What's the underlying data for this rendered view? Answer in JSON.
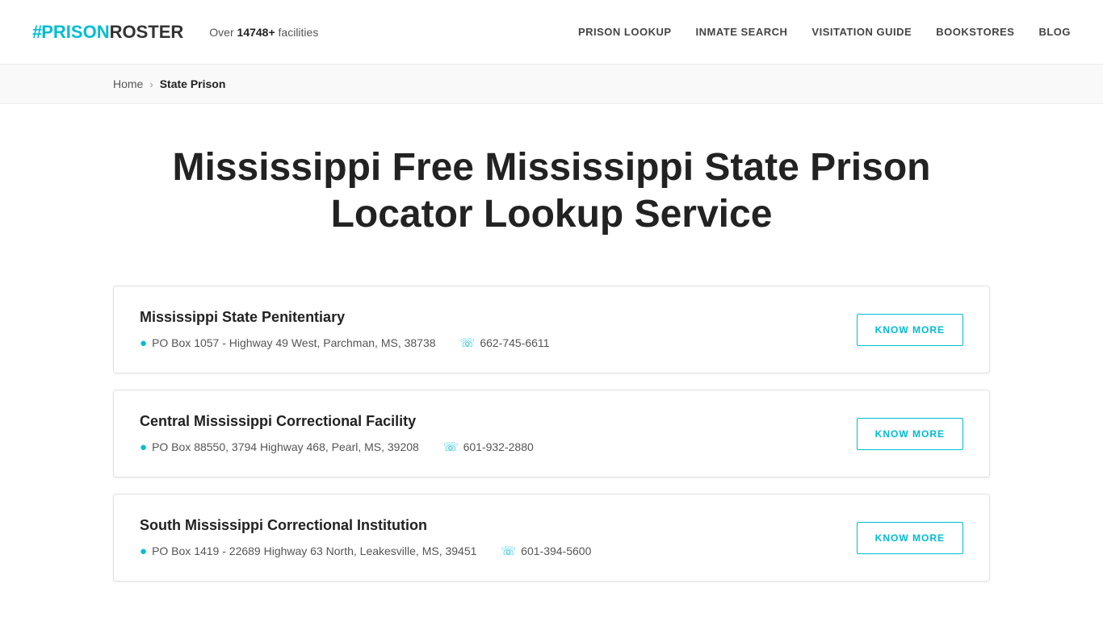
{
  "header": {
    "logo": {
      "hash": "#",
      "prison": "PRISON",
      "roster": "ROSTER"
    },
    "facilities_text": "Over ",
    "facilities_count": "14748+",
    "facilities_suffix": " facilities",
    "nav": [
      {
        "id": "prison-lookup",
        "label": "PRISON LOOKUP"
      },
      {
        "id": "inmate-search",
        "label": "INMATE SEARCH"
      },
      {
        "id": "visitation-guide",
        "label": "VISITATION GUIDE"
      },
      {
        "id": "bookstores",
        "label": "BOOKSTORES"
      },
      {
        "id": "blog",
        "label": "BLOG"
      }
    ]
  },
  "breadcrumb": {
    "home": "Home",
    "separator": "›",
    "current": "State Prison"
  },
  "page": {
    "title": "Mississippi Free Mississippi State Prison Locator Lookup Service"
  },
  "facilities": [
    {
      "id": "mississippi-state-penitentiary",
      "name": "Mississippi State Penitentiary",
      "address": "PO Box 1057 - Highway 49 West, Parchman, MS, 38738",
      "phone": "662-745-6611",
      "button_label": "KNOW MORE"
    },
    {
      "id": "central-mississippi-correctional",
      "name": "Central Mississippi Correctional Facility",
      "address": "PO Box 88550, 3794 Highway 468, Pearl, MS, 39208",
      "phone": "601-932-2880",
      "button_label": "KNOW MORE"
    },
    {
      "id": "south-mississippi-correctional",
      "name": "South Mississippi Correctional Institution",
      "address": "PO Box 1419 - 22689 Highway 63 North, Leakesville, MS, 39451",
      "phone": "601-394-5600",
      "button_label": "KNOW MORE"
    }
  ]
}
